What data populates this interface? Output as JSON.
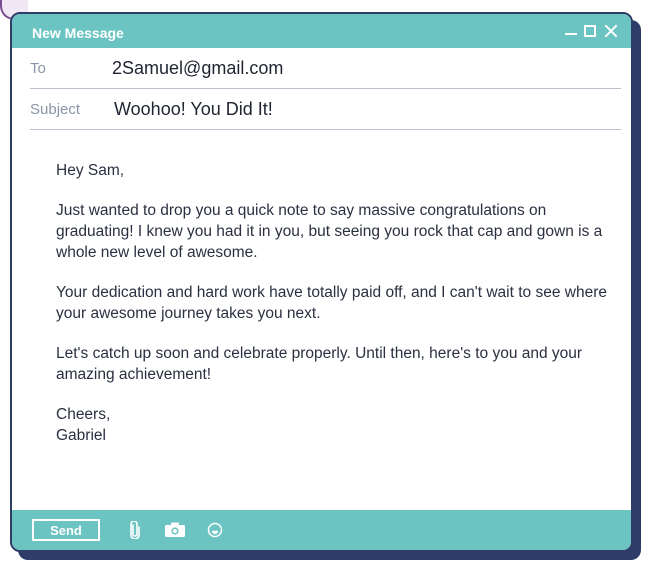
{
  "window": {
    "title": "New Message"
  },
  "fields": {
    "to_label": "To",
    "to_value": "2Samuel@gmail.com",
    "subject_label": "Subject",
    "subject_value": "Woohoo! You Did It!"
  },
  "body": {
    "greeting": "Hey Sam,",
    "paragraph1": "Just wanted to drop you a quick note to say massive congratulations on graduating! I knew you had it in you, but seeing you rock that cap and gown is a whole new level of awesome.",
    "paragraph2": "Your dedication and hard work have totally paid off, and I can't wait to see where your awesome journey takes you next.",
    "paragraph3": "Let's catch up soon and celebrate properly. Until then, here's to you and your amazing achievement!",
    "signoff": "Cheers,",
    "signature": "Gabriel"
  },
  "footer": {
    "send_label": "Send",
    "icons": [
      "paperclip-icon",
      "camera-icon",
      "emoji-icon"
    ]
  },
  "colors": {
    "accent": "#6cc4c2",
    "frame": "#2e3c68",
    "label": "#8a96a6"
  }
}
